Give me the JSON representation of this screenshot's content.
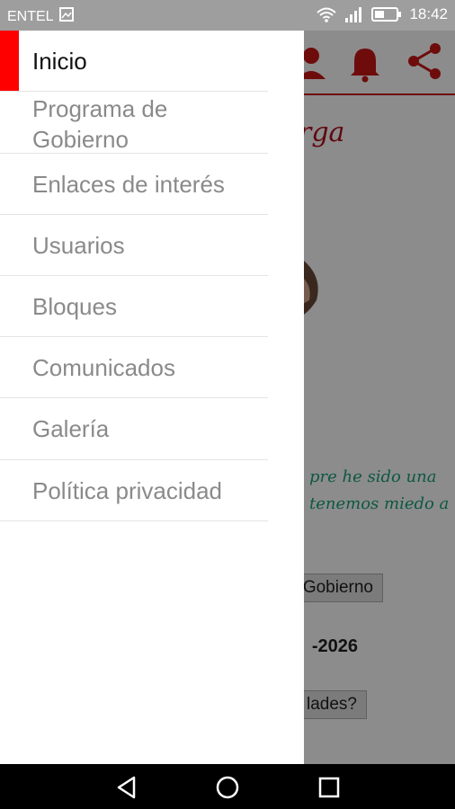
{
  "status_bar": {
    "carrier": "ENTEL",
    "time": "18:42",
    "icons": [
      "photo-notification-icon",
      "wifi-icon",
      "signal-icon",
      "battery-icon"
    ]
  },
  "app": {
    "header_icons": [
      "user-icon",
      "bell-icon",
      "share-icon"
    ],
    "brand_fragment": "rga",
    "quote_fragment": "pre he sido una\ntenemos miedo a",
    "program_button": "Gobierno",
    "period_text": "-2026",
    "needs_button": "lades?",
    "accent_color": "#c81616"
  },
  "drawer": {
    "items": [
      {
        "label": "Inicio",
        "active": true
      },
      {
        "label": "Programa de\nGobierno",
        "active": false
      },
      {
        "label": "Enlaces de interés",
        "active": false
      },
      {
        "label": "Usuarios",
        "active": false
      },
      {
        "label": "Bloques",
        "active": false
      },
      {
        "label": "Comunicados",
        "active": false
      },
      {
        "label": "Galería",
        "active": false
      },
      {
        "label": "Política privacidad",
        "active": false
      }
    ],
    "active_accent_color": "#ff0000"
  },
  "nav_bar": {
    "buttons": [
      "back-icon",
      "home-icon",
      "recents-icon"
    ]
  }
}
